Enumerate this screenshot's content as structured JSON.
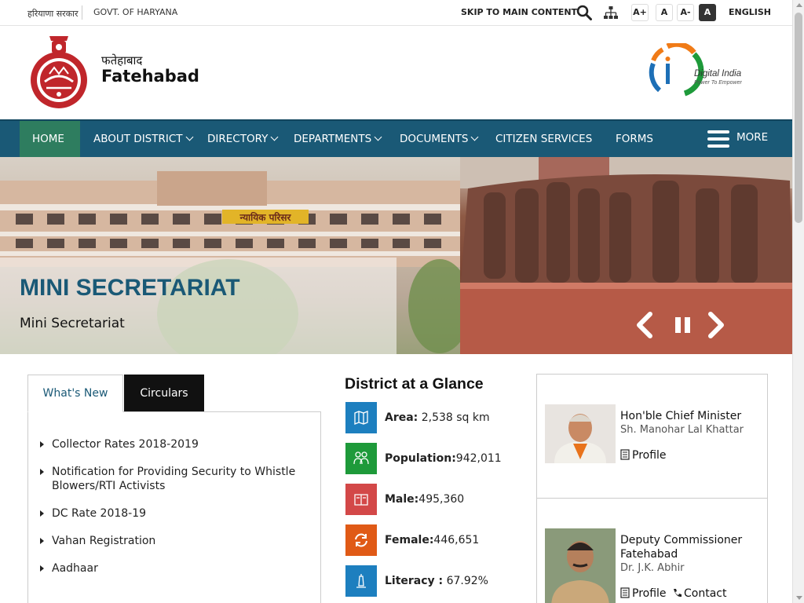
{
  "topbar": {
    "hindi_label": "हरियाणा सरकार",
    "govt_label": "GOVT. OF HARYANA",
    "skip_label": "SKIP TO MAIN CONTENT",
    "font_increase": "A+",
    "font_normal": "A",
    "font_decrease": "A-",
    "contrast": "A",
    "language": "ENGLISH"
  },
  "header": {
    "district_hindi": "फतेहाबाद",
    "district_name": "Fatehabad",
    "emblem_text": "GOVT. OF HARYANA",
    "digital_india_title": "Digital India",
    "digital_india_tagline": "Power To Empower"
  },
  "nav": {
    "home": "HOME",
    "about": "ABOUT DISTRICT",
    "directory": "DIRECTORY",
    "departments": "DEPARTMENTS",
    "documents": "DOCUMENTS",
    "citizen": "CITIZEN SERVICES",
    "forms": "FORMS",
    "more": "MORE"
  },
  "banner": {
    "title": "MINI SECRETARIAT",
    "subtitle": "Mini Secretariat",
    "building_sign": "न्यायिक परिसर"
  },
  "tabs": {
    "whats_new": "What's New",
    "circulars": "Circulars"
  },
  "news": [
    "Collector Rates 2018-2019",
    "Notification for Providing Security to Whistle Blowers/RTI Activists",
    "DC Rate 2018-19",
    "Vahan Registration",
    "Aadhaar"
  ],
  "glance": {
    "title": "District at a Glance",
    "area_label": "Area:",
    "area_value": " 2,538 sq km",
    "population_label": "Population:",
    "population_value": "942,011",
    "male_label": "Male:",
    "male_value": "495,360",
    "female_label": "Female:",
    "female_value": "446,651",
    "literacy_label": "Literacy :",
    "literacy_value": " 67.92%"
  },
  "officials": {
    "cm_title": "Hon'ble Chief Minister",
    "cm_name": "Sh. Manohar Lal Khattar",
    "cm_profile": "Profile",
    "dc_title": "Deputy Commissioner Fatehabad",
    "dc_name": "Dr. J.K. Abhir",
    "dc_profile": "Profile",
    "dc_contact": "Contact"
  },
  "colors": {
    "nav_bg": "#1a5976",
    "nav_active": "#2e7d5f",
    "area_icon": "#1d7fbf",
    "population_icon": "#1e9a3a",
    "male_icon": "#d34848",
    "female_icon": "#e05a16",
    "literacy_icon": "#1d7fbf"
  }
}
